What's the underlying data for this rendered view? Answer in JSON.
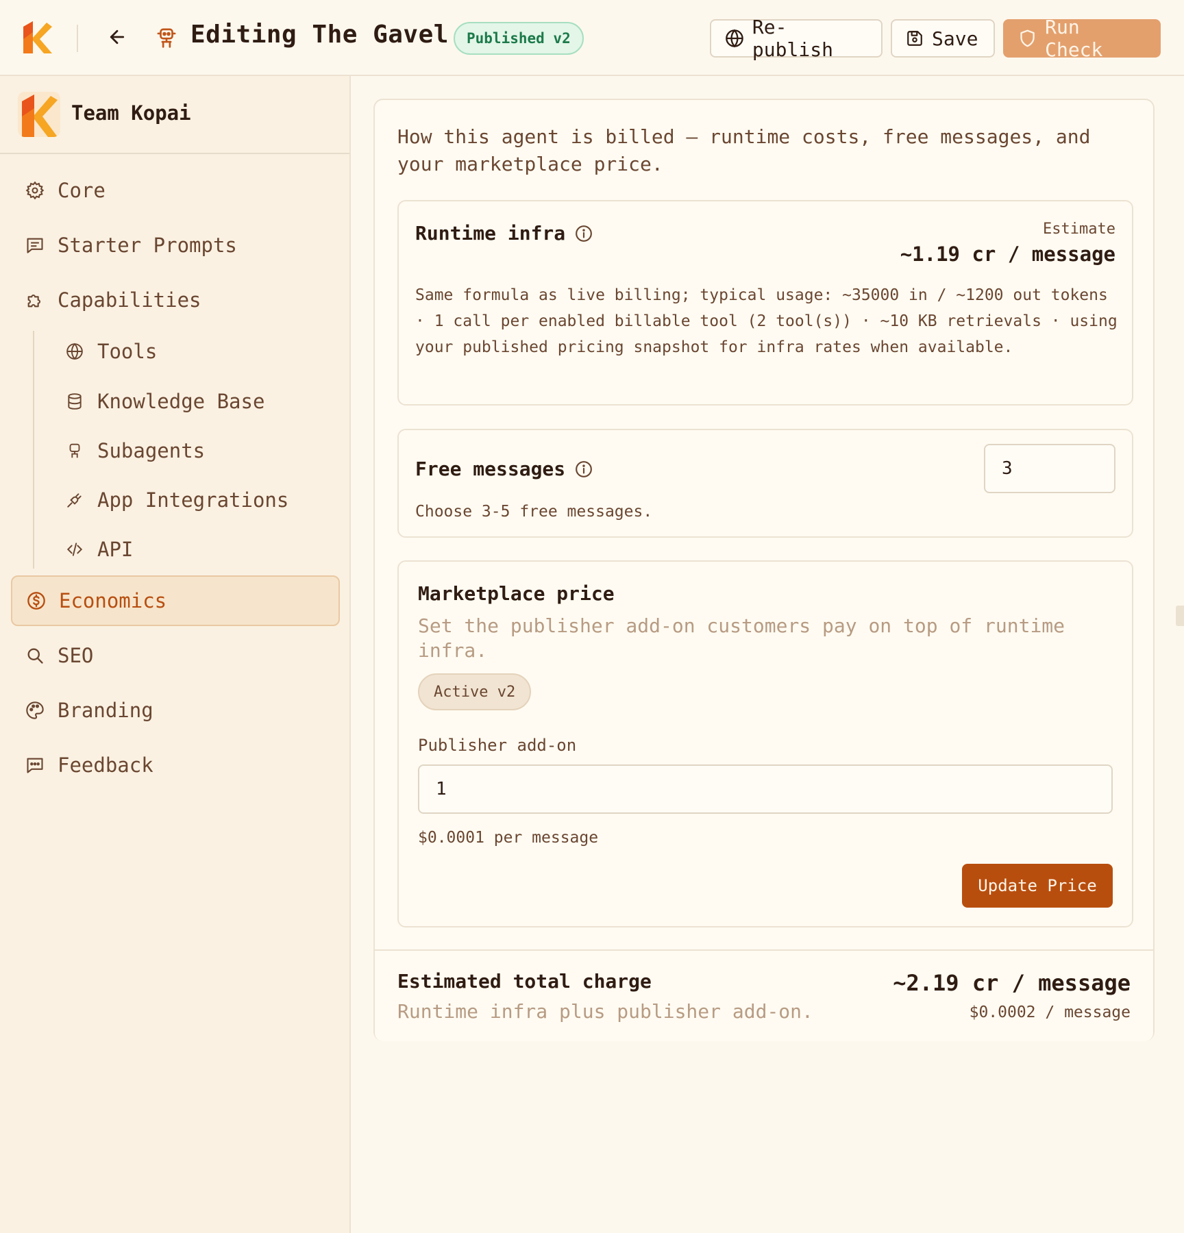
{
  "header": {
    "title": "Editing The Gavel",
    "status_badge": "Published v2",
    "republish_label": "Re-publish",
    "save_label": "Save",
    "run_check_label": "Run Check"
  },
  "colors": {
    "accent": "#b84e0e",
    "accent_light": "#e3a06d",
    "background": "#fdf8ee",
    "sidebar": "#faf1e2",
    "success": "#1d7a4a"
  },
  "sidebar": {
    "team_name": "Team Kopai",
    "items": [
      {
        "label": "Core",
        "icon": "gear-icon"
      },
      {
        "label": "Starter Prompts",
        "icon": "message-square-icon"
      },
      {
        "label": "Capabilities",
        "icon": "puzzle-icon"
      },
      {
        "label": "Tools",
        "icon": "globe-icon"
      },
      {
        "label": "Knowledge Base",
        "icon": "database-icon"
      },
      {
        "label": "Subagents",
        "icon": "robot-icon"
      },
      {
        "label": "App Integrations",
        "icon": "plug-icon"
      },
      {
        "label": "API",
        "icon": "code-icon"
      },
      {
        "label": "Economics",
        "icon": "dollar-circle-icon",
        "active": true
      },
      {
        "label": "SEO",
        "icon": "search-icon"
      },
      {
        "label": "Branding",
        "icon": "palette-icon"
      },
      {
        "label": "Feedback",
        "icon": "message-dots-icon"
      }
    ]
  },
  "economics": {
    "intro": "How this agent is billed — runtime costs, free messages, and your marketplace price.",
    "runtime": {
      "title": "Runtime infra",
      "estimate_label": "Estimate",
      "estimate_value": "~1.19 cr / message",
      "description": "Same formula as live billing; typical usage: ~35000 in / ~1200 out tokens · 1 call per enabled billable tool (2 tool(s)) · ~10 KB retrievals · using your published pricing snapshot for infra rates when available."
    },
    "free_messages": {
      "title": "Free messages",
      "value": "3",
      "hint": "Choose 3-5 free messages."
    },
    "marketplace": {
      "title": "Marketplace price",
      "subtitle": "Set the publisher add-on customers pay on top of runtime infra.",
      "version_pill": "Active v2",
      "field_label": "Publisher add-on",
      "field_value": "1",
      "per_message": "$0.0001 per message",
      "update_label": "Update Price"
    },
    "total": {
      "title": "Estimated total charge",
      "subtitle": "Runtime infra plus publisher add-on.",
      "value": "~2.19 cr / message",
      "usd": "$0.0002 / message"
    }
  }
}
